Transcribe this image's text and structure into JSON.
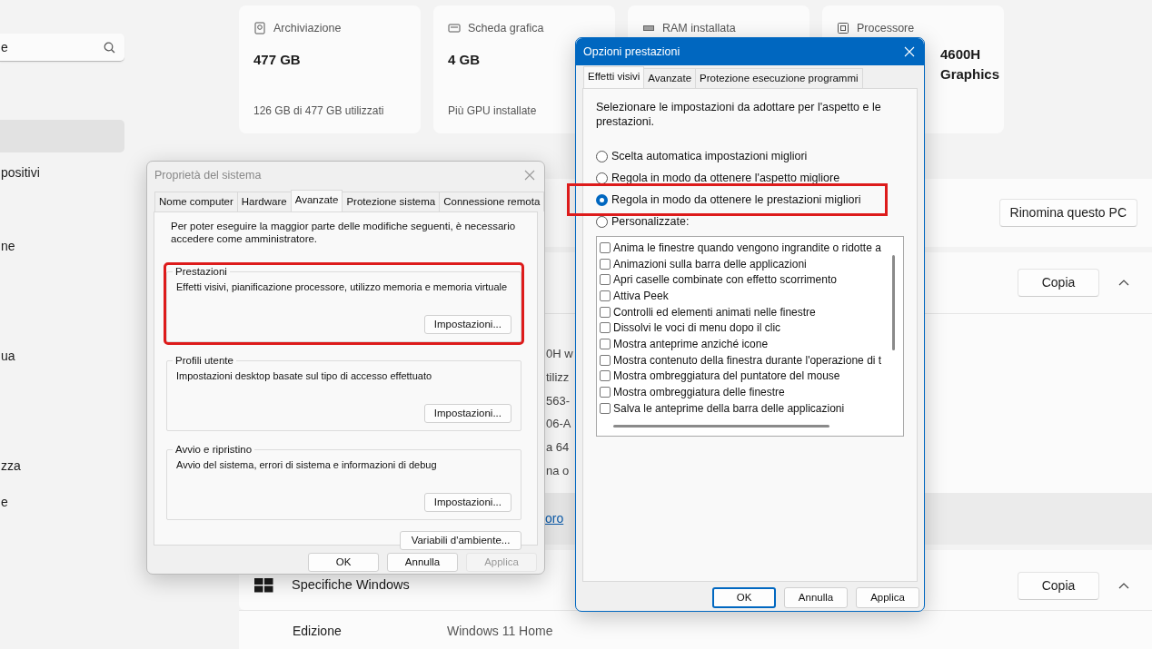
{
  "search": {
    "value": "e"
  },
  "sidebar": {
    "items": [
      {
        "selected": true
      },
      {
        "label": "positivi",
        "selected": false
      },
      {
        "label": "ne",
        "selected": false
      },
      {
        "label": "ua",
        "selected": false
      },
      {
        "label": "zza",
        "selected": false
      },
      {
        "label": "e",
        "selected": false
      }
    ]
  },
  "spec_cards": [
    {
      "label": "Archiviazione",
      "value": "477 GB",
      "footer": "126 GB di 477 GB utilizzati"
    },
    {
      "label": "Scheda grafica",
      "value": "4 GB",
      "footer": "Più GPU installate"
    },
    {
      "label": "RAM installata"
    },
    {
      "label": "Processore",
      "value_lines": [
        "4600H",
        "Graphics"
      ]
    }
  ],
  "device_panel": {
    "rename_button": "Rinomina questo PC"
  },
  "device_specs": {
    "copy_button": "Copia",
    "expanded": true,
    "fragments": [
      "0H w",
      "tilizz",
      "563-",
      "06-A",
      "a 64",
      "na o"
    ],
    "link": "oro"
  },
  "windows_specs": {
    "title": "Specifiche Windows",
    "copy_button": "Copia",
    "expanded": true,
    "rows": [
      {
        "label": "Edizione",
        "value": "Windows 11 Home"
      }
    ]
  },
  "system_properties": {
    "title": "Proprietà del sistema",
    "active": false,
    "tabs": [
      {
        "label": "Nome computer",
        "selected": false
      },
      {
        "label": "Hardware",
        "selected": false
      },
      {
        "label": "Avanzate",
        "selected": true
      },
      {
        "label": "Protezione sistema",
        "selected": false
      },
      {
        "label": "Connessione remota",
        "selected": false
      }
    ],
    "note": "Per poter eseguire la maggior parte delle modifiche seguenti, è necessario accedere come amministratore.",
    "groups": [
      {
        "title": "Prestazioni",
        "description": "Effetti visivi, pianificazione processore, utilizzo memoria e memoria virtuale",
        "button": "Impostazioni...",
        "highlighted": true
      },
      {
        "title": "Profili utente",
        "description": "Impostazioni desktop basate sul tipo di accesso effettuato",
        "button": "Impostazioni...",
        "highlighted": false
      },
      {
        "title": "Avvio e ripristino",
        "description": "Avvio del sistema, errori di sistema e informazioni di debug",
        "button": "Impostazioni...",
        "highlighted": false
      }
    ],
    "env_button": "Variabili d'ambiente...",
    "buttons": [
      {
        "label": "OK",
        "disabled": false
      },
      {
        "label": "Annulla",
        "disabled": false
      },
      {
        "label": "Applica",
        "disabled": true
      }
    ]
  },
  "performance_options": {
    "title": "Opzioni prestazioni",
    "active": true,
    "tabs": [
      {
        "label": "Effetti visivi",
        "selected": true
      },
      {
        "label": "Avanzate",
        "selected": false
      },
      {
        "label": "Protezione esecuzione programmi",
        "selected": false
      }
    ],
    "intro": "Selezionare le impostazioni da adottare per l'aspetto e le prestazioni.",
    "options": [
      {
        "label": "Scelta automatica impostazioni migliori",
        "selected": false,
        "highlighted": false
      },
      {
        "label": "Regola in modo da ottenere l'aspetto migliore",
        "selected": false,
        "highlighted": false
      },
      {
        "label": "Regola in modo da ottenere le prestazioni migliori",
        "selected": true,
        "highlighted": true
      },
      {
        "label": "Personalizzate:",
        "selected": false,
        "highlighted": false
      }
    ],
    "effects": [
      {
        "label": "Anima le finestre quando vengono ingrandite o ridotte a",
        "checked": false
      },
      {
        "label": "Animazioni sulla barra delle applicazioni",
        "checked": false
      },
      {
        "label": "Apri caselle combinate con effetto scorrimento",
        "checked": false
      },
      {
        "label": "Attiva Peek",
        "checked": false
      },
      {
        "label": "Controlli ed elementi animati nelle finestre",
        "checked": false
      },
      {
        "label": "Dissolvi le voci di menu dopo il clic",
        "checked": false
      },
      {
        "label": "Mostra anteprime anziché icone",
        "checked": false
      },
      {
        "label": "Mostra contenuto della finestra durante l'operazione di t",
        "checked": false
      },
      {
        "label": "Mostra ombreggiatura del puntatore del mouse",
        "checked": false
      },
      {
        "label": "Mostra ombreggiatura delle finestre",
        "checked": false
      },
      {
        "label": "Salva le anteprime della barra delle applicazioni",
        "checked": false
      }
    ],
    "buttons": [
      {
        "label": "OK",
        "default": true
      },
      {
        "label": "Annulla",
        "default": false
      },
      {
        "label": "Applica",
        "default": false
      }
    ]
  }
}
